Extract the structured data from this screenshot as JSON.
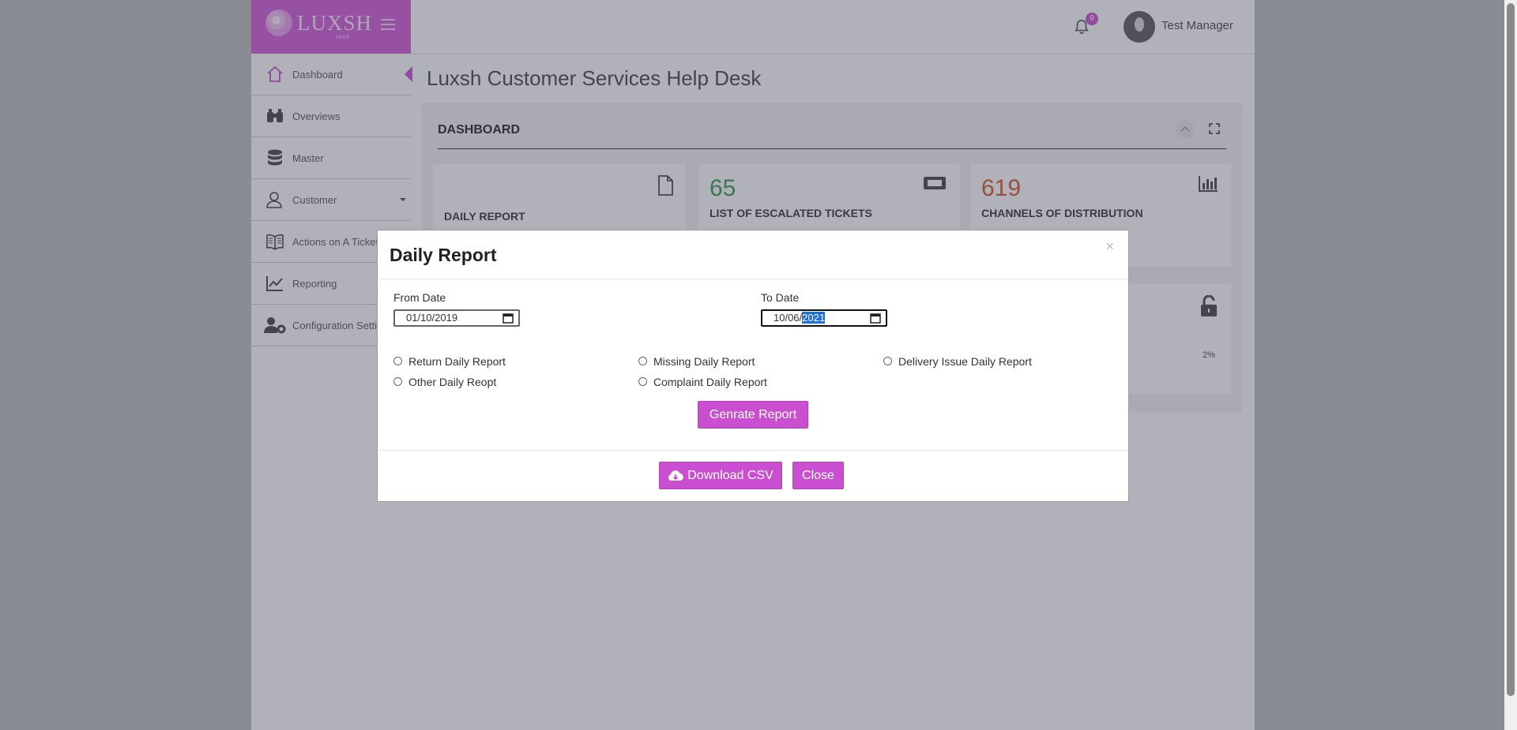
{
  "brand": {
    "name": "LUXSH",
    "sub": "tech",
    "accent": "#c94fd0"
  },
  "header": {
    "notification_count": "9",
    "user_name": "Test Manager"
  },
  "sidebar": {
    "items": [
      {
        "label": "Dashboard",
        "icon": "home-icon"
      },
      {
        "label": "Overviews",
        "icon": "binoculars-icon"
      },
      {
        "label": "Master",
        "icon": "database-icon"
      },
      {
        "label": "Customer",
        "icon": "user-icon"
      },
      {
        "label": "Actions on A Ticket",
        "icon": "book-icon"
      },
      {
        "label": "Reporting",
        "icon": "chart-line-icon"
      },
      {
        "label": "Configuration Settings",
        "icon": "user-cog-icon"
      }
    ]
  },
  "main": {
    "title": "Luxsh Customer Services Help Desk",
    "panel_title": "DASHBOARD",
    "cards": [
      {
        "label": "DAILY REPORT",
        "icon": "file-icon"
      },
      {
        "number": "65",
        "label": "LIST OF ESCALATED TICKETS",
        "icon": "ticket-icon",
        "color": "#3a9a4a"
      },
      {
        "number": "619",
        "label": "CHANNELS OF DISTRIBUTION",
        "icon": "bar-chart-icon",
        "color": "#d2572a"
      }
    ],
    "lower_card": {
      "percent": "2%",
      "icon": "unlock-icon"
    }
  },
  "modal": {
    "title": "Daily Report",
    "close_x": "×",
    "from_label": "From Date",
    "from_value": "01/10/2019",
    "to_label": "To Date",
    "to_value_prefix": "10/06/",
    "to_value_selected": "2021",
    "radios": [
      "Return Daily Report",
      "Missing Daily Report",
      "Delivery Issue Daily Report",
      "Other Daily Reopt",
      "Complaint Daily Report"
    ],
    "generate_label": "Genrate Report",
    "download_label": "Download CSV",
    "close_label": "Close"
  }
}
